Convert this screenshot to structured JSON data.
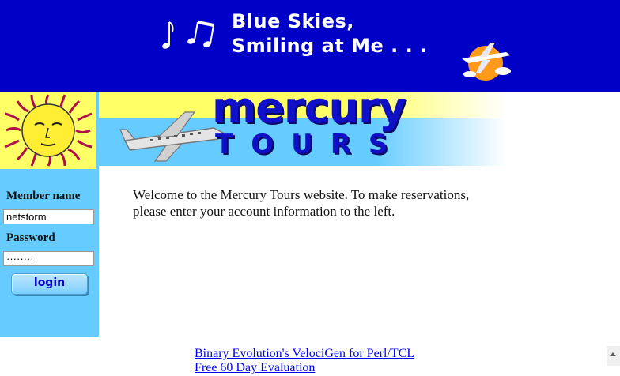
{
  "banner": {
    "line1": "Blue Skies,",
    "line2": "Smiling at Me . . .",
    "bg_color": "#0000c6"
  },
  "logo": {
    "word": "mercury",
    "sub": "TOURS"
  },
  "sidebar": {
    "member_label": "Member name",
    "member_value": "netstorm",
    "password_label": "Password",
    "password_value": "········",
    "login_label": "login"
  },
  "main": {
    "welcome": "Welcome to the Mercury Tours website. To make reservations, please enter your account information to the left."
  },
  "footer": {
    "link1": "Binary Evolution's VelociGen for Perl/TCL",
    "link2": "Free 60 Day Evaluation"
  },
  "icons": {
    "music_notes": "music-notes-icon",
    "plane_sun": "plane-sun-icon",
    "sun_face": "sun-face-icon",
    "airplane": "airplane-icon"
  }
}
